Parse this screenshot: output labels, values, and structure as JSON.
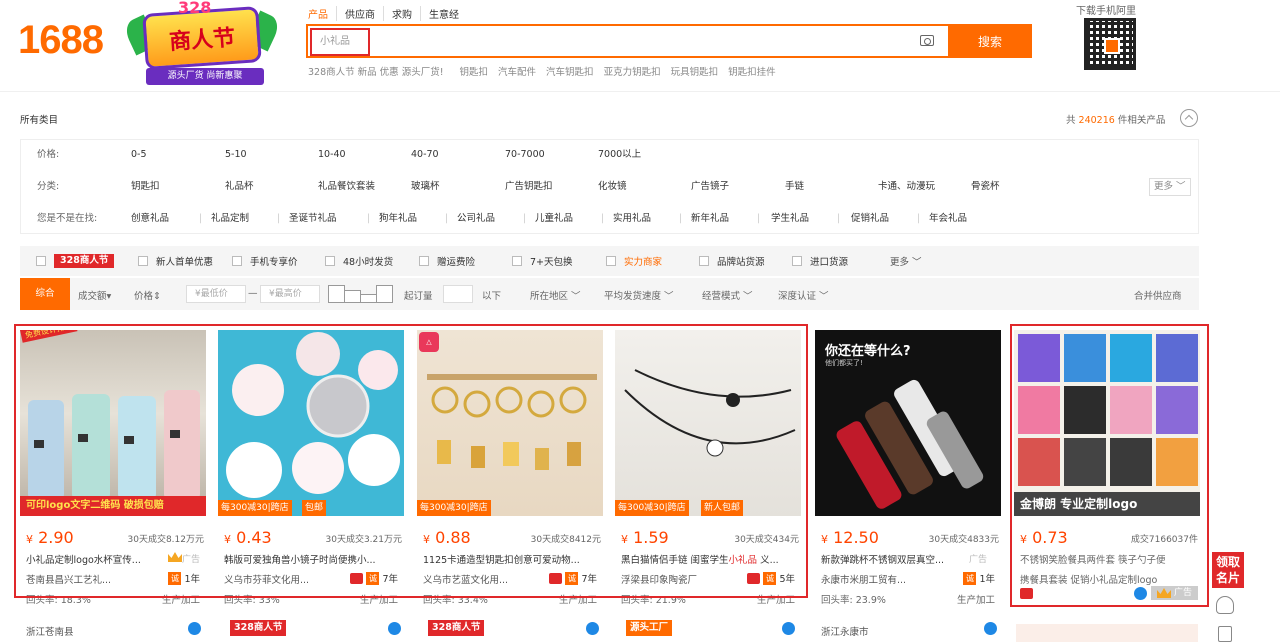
{
  "header": {
    "logo": "1688",
    "banner_top": "328",
    "banner_main": "商人节",
    "banner_sub": "源头厂货 尚新惠聚",
    "search_tabs": [
      "产品",
      "供应商",
      "求购",
      "生意经"
    ],
    "search_value": "小礼品",
    "search_button": "搜索",
    "hot_promo": "328商人节 新品 优惠 源头厂货!",
    "hot_words": [
      "钥匙扣",
      "汽车配件",
      "汽车钥匙扣",
      "亚克力钥匙扣",
      "玩具钥匙扣",
      "钥匙扣挂件"
    ],
    "qr_label": "下载手机阿里"
  },
  "category": {
    "all": "所有类目",
    "total_prefix": "共",
    "total_count": "240216",
    "total_suffix": "件相关产品"
  },
  "filters": {
    "price_label": "价格:",
    "price_options": [
      "0-5",
      "5-10",
      "10-40",
      "40-70",
      "70-7000",
      "7000以上"
    ],
    "category_label": "分类:",
    "category_options": [
      "钥匙扣",
      "礼品杯",
      "礼品餐饮套装",
      "玻璃杯",
      "广告钥匙扣",
      "化妆镜",
      "广告镜子",
      "手链",
      "卡通、动漫玩",
      "骨瓷杯"
    ],
    "more": "更多",
    "suggest_label": "您是不是在找:",
    "suggest_options": [
      "创意礼品",
      "礼品定制",
      "圣诞节礼品",
      "狗年礼品",
      "公司礼品",
      "儿童礼品",
      "实用礼品",
      "新年礼品",
      "学生礼品",
      "促销礼品",
      "年会礼品"
    ]
  },
  "sort_bar1": {
    "tag_328": "328商人节",
    "items": [
      "新人首单优惠",
      "手机专享价",
      "48小时发货",
      "赠运费险",
      "7+天包换",
      "实力商家",
      "品牌站货源",
      "进口货源"
    ],
    "more": "更多"
  },
  "sort_bar2": {
    "active": "综合",
    "sales": "成交额",
    "price": "价格",
    "min_price": "¥最低价",
    "dash": "—",
    "max_price": "¥最高价",
    "moq": "起订量",
    "below": "以下",
    "region": "所在地区",
    "ship_speed": "平均发货速度",
    "biz_mode": "经营模式",
    "depth_cert": "深度认证",
    "merge": "合并供应商"
  },
  "products": [
    {
      "price": "2.90",
      "sold": "30天成交8.12万元",
      "title": "小礼品定制logo水杯宣传...",
      "ad": "广告",
      "company": "苍南县昌兴工艺礼...",
      "years": "1年",
      "repurchase": "回头率: 18.3%",
      "biz": "生产加工",
      "loc": "浙江苍南县",
      "img_banner": "可印logo文字二维码  破损包赔",
      "img_corner": "免费设计排版"
    },
    {
      "price": "0.43",
      "sold": "30天成交3.21万元",
      "title": "韩版可爱独角兽小镜子时尚便携小...",
      "company": "义乌市芬菲文化用...",
      "years": "7年",
      "repurchase": "回头率: 33%",
      "biz": "生产加工",
      "tag1": "每300减30|跨店",
      "tag2": "包邮",
      "bottom_tag": "328商人节"
    },
    {
      "price": "0.88",
      "sold": "30天成交8412元",
      "title": "1125卡通造型钥匙扣创意可爱动物...",
      "company": "义乌市艺蓝文化用...",
      "years": "7年",
      "repurchase": "回头率: 33.4%",
      "biz": "生产加工",
      "tag1": "每300减30|跨店",
      "bottom_tag": "328商人节"
    },
    {
      "price": "1.59",
      "sold": "30天成交434元",
      "title_pre": "黑白猫情侣手链 闺蜜学生",
      "title_hl": "小礼品",
      "title_post": " 义...",
      "company": "浮梁县印象陶瓷厂",
      "years": "5年",
      "repurchase": "回头率: 21.9%",
      "biz": "生产加工",
      "tag1": "每300减30|跨店",
      "tag2": "新人包邮",
      "bottom_tag": "源头工厂"
    },
    {
      "price": "12.50",
      "sold": "30天成交4833元",
      "title": "新款弹跳杯不锈钢双层真空...",
      "ad": "广告",
      "company": "永康市米朋工贸有...",
      "years": "1年",
      "repurchase": "回头率: 23.9%",
      "biz": "生产加工",
      "loc": "浙江永康市",
      "img_headline": "你还在等什么?",
      "img_sub": "他们都买了!"
    },
    {
      "price": "0.73",
      "sold": "成交7166037件",
      "title": "不锈钢笑脸餐具两件套 筷子勺子便",
      "title2": "携餐具套装 促销小礼品定制logo",
      "ad": "广告",
      "img_banner": "金博朗 专业定制logo"
    }
  ],
  "side": {
    "card_label": "领取名片"
  },
  "colors": {
    "brand": "#ff6a00",
    "price": "#ff4400",
    "highlight": "#e0282a"
  }
}
